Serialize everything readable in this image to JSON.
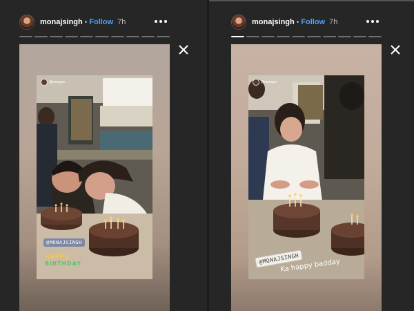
{
  "stories": [
    {
      "username": "monajsingh",
      "separator": "•",
      "follow_label": "Follow",
      "time": "7h",
      "progress_total": 10,
      "progress_done": 0,
      "sticker_tag": "@MONAJSINGH",
      "mini_tag": "@sonagor",
      "greeting_line1": "HAPPY",
      "greeting_line2": "BIRTHDAY"
    },
    {
      "username": "monajsingh",
      "separator": "•",
      "follow_label": "Follow",
      "time": "7h",
      "progress_total": 10,
      "progress_done": 1,
      "sticker_tag": "@MONAJSINGH",
      "mini_tag": "@sonagor",
      "caption": "Ka happy badday"
    }
  ],
  "icons": {
    "close": "close-icon",
    "more": "more-options-icon",
    "avatar": "profile-avatar"
  },
  "colors": {
    "background": "#262626",
    "follow": "#4da3ff",
    "happy_yellow": "#f6c845",
    "happy_green": "#58c56a"
  }
}
